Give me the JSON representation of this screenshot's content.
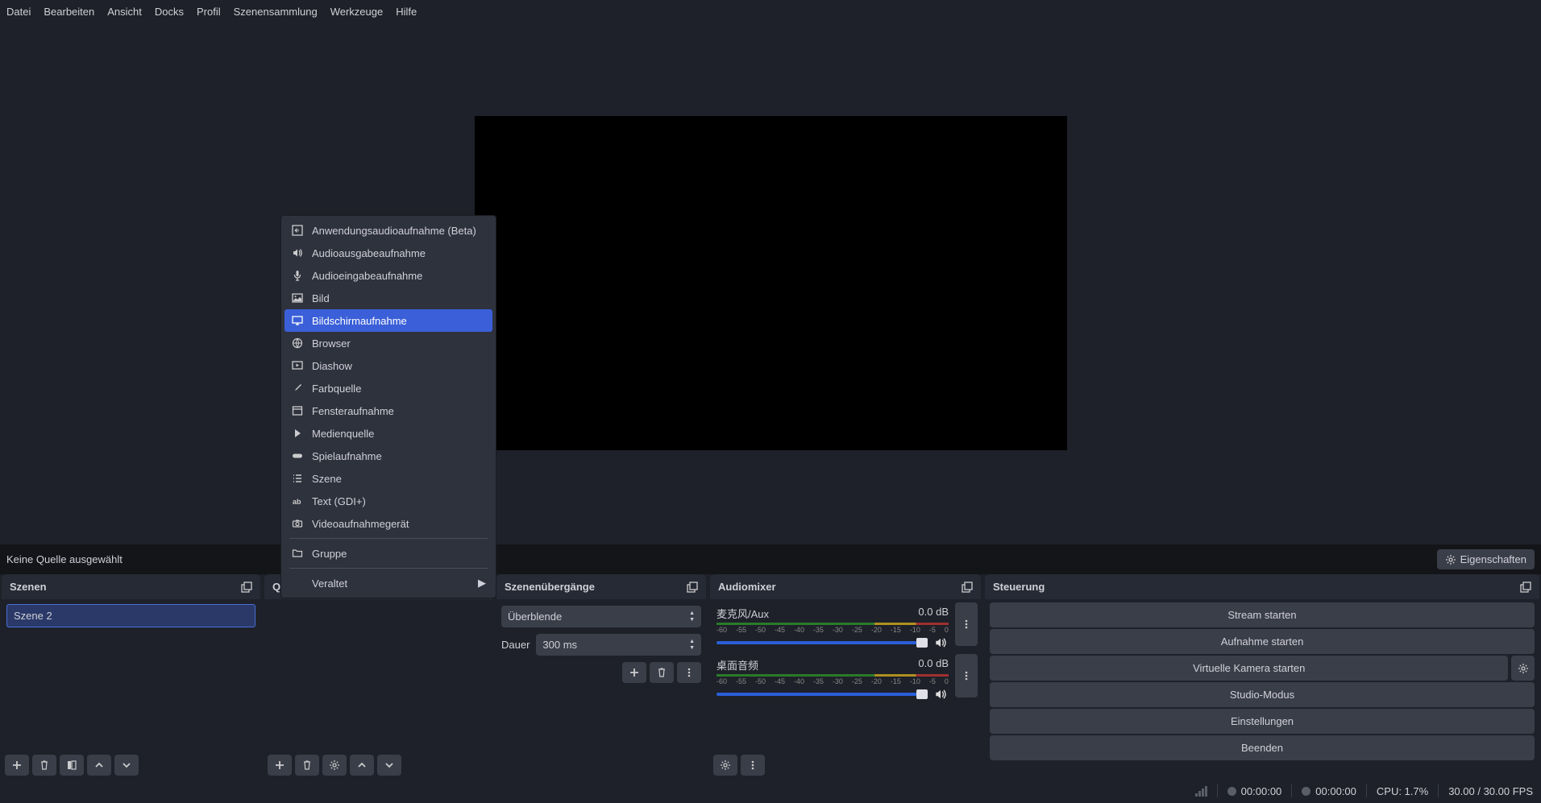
{
  "menubar": [
    "Datei",
    "Bearbeiten",
    "Ansicht",
    "Docks",
    "Profil",
    "Szenensammlung",
    "Werkzeuge",
    "Hilfe"
  ],
  "info_bar": {
    "no_source": "Keine Quelle ausgewählt",
    "properties": "Eigenschaften"
  },
  "docks": {
    "scenes": {
      "title": "Szenen",
      "items": [
        "Szene 2"
      ]
    },
    "sources": {
      "title_initial": "Q"
    },
    "transitions": {
      "title": "Szenenübergänge",
      "selected": "Überblende",
      "duration_label": "Dauer",
      "duration_value": "300 ms"
    },
    "mixer": {
      "title": "Audiomixer",
      "channels": [
        {
          "name": "麦克风/Aux",
          "db": "0.0 dB"
        },
        {
          "name": "桌面音频",
          "db": "0.0 dB"
        }
      ],
      "ticks": [
        "-60",
        "-55",
        "-50",
        "-45",
        "-40",
        "-35",
        "-30",
        "-25",
        "-20",
        "-15",
        "-10",
        "-5",
        "0"
      ]
    },
    "controls": {
      "title": "Steuerung",
      "buttons": [
        "Stream starten",
        "Aufnahme starten",
        "Virtuelle Kamera starten",
        "Studio-Modus",
        "Einstellungen",
        "Beenden"
      ]
    }
  },
  "status": {
    "time1": "00:00:00",
    "time2": "00:00:00",
    "cpu": "CPU: 1.7%",
    "fps": "30.00 / 30.00 FPS"
  },
  "context_menu": {
    "items": [
      {
        "icon": "app-audio",
        "label": "Anwendungsaudioaufnahme (Beta)"
      },
      {
        "icon": "speaker",
        "label": "Audioausgabeaufnahme"
      },
      {
        "icon": "mic",
        "label": "Audioeingabeaufnahme"
      },
      {
        "icon": "image",
        "label": "Bild"
      },
      {
        "icon": "monitor",
        "label": "Bildschirmaufnahme",
        "highlighted": true
      },
      {
        "icon": "globe",
        "label": "Browser"
      },
      {
        "icon": "slideshow",
        "label": "Diashow"
      },
      {
        "icon": "brush",
        "label": "Farbquelle"
      },
      {
        "icon": "window",
        "label": "Fensteraufnahme"
      },
      {
        "icon": "play",
        "label": "Medienquelle"
      },
      {
        "icon": "gamepad",
        "label": "Spielaufnahme"
      },
      {
        "icon": "list",
        "label": "Szene"
      },
      {
        "icon": "text",
        "label": "Text (GDI+)"
      },
      {
        "icon": "camera",
        "label": "Videoaufnahmegerät"
      }
    ],
    "group": "Gruppe",
    "deprecated": "Veraltet"
  }
}
